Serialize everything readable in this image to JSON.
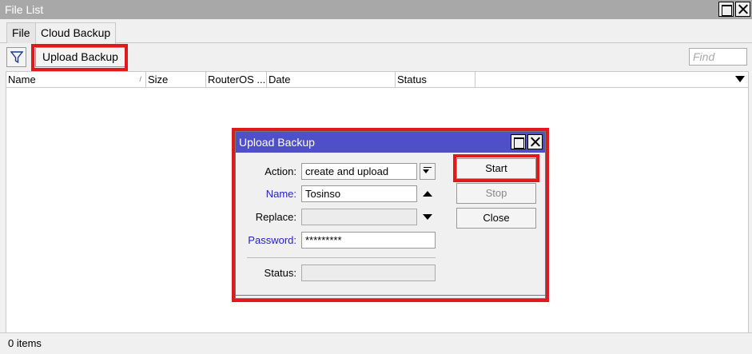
{
  "window": {
    "title": "File List"
  },
  "tabs": [
    {
      "label": "File",
      "active": false
    },
    {
      "label": "Cloud Backup",
      "active": true
    }
  ],
  "toolbar": {
    "filter_icon": "funnel-icon",
    "upload_label": "Upload Backup",
    "find_placeholder": "Find"
  },
  "table": {
    "columns": [
      "Name",
      "Size",
      "RouterOS ...",
      "Date",
      "Status",
      ""
    ],
    "sort_indicator": "/",
    "rows": []
  },
  "status_bar": {
    "text": "0 items"
  },
  "dialog": {
    "title": "Upload Backup",
    "fields": {
      "action": {
        "label": "Action:",
        "value": "create and upload"
      },
      "name": {
        "label": "Name:",
        "value": "Tosinso"
      },
      "replace": {
        "label": "Replace:",
        "value": ""
      },
      "password": {
        "label": "Password:",
        "value": "*********"
      },
      "status": {
        "label": "Status:",
        "value": ""
      }
    },
    "buttons": {
      "start": "Start",
      "stop": "Stop",
      "close": "Close"
    }
  },
  "colors": {
    "highlight": "#e01a1a",
    "dialog_title_bg": "#4f4fc9",
    "window_title_bg": "#a8a8a8",
    "blue_label": "#2323c8"
  }
}
